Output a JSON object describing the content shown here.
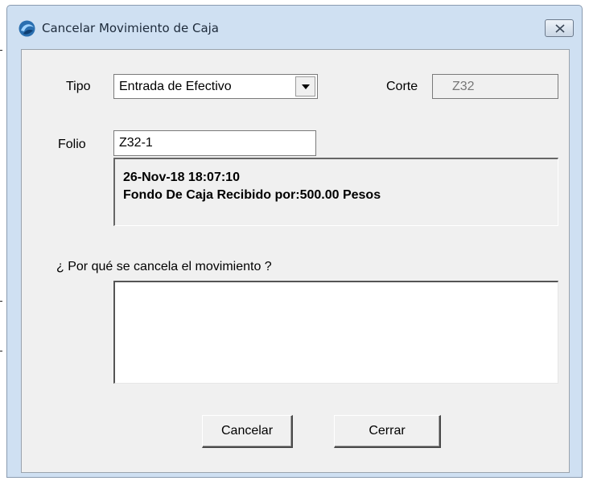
{
  "window": {
    "title": "Cancelar Movimiento de Caja",
    "icon": "app-logo-icon",
    "close_icon": "close-icon"
  },
  "form": {
    "tipo_label": "Tipo",
    "tipo_value": "Entrada de Efectivo",
    "corte_label": "Corte",
    "corte_value": "Z32",
    "folio_label": "Folio",
    "folio_value": "Z32-1",
    "info_line1": "26-Nov-18 18:07:10",
    "info_line2": "Fondo De Caja Recibido por:500.00 Pesos",
    "reason_label": "¿ Por qué se cancela el movimiento ?",
    "reason_value": ""
  },
  "buttons": {
    "cancelar": "Cancelar",
    "cerrar": "Cerrar"
  }
}
